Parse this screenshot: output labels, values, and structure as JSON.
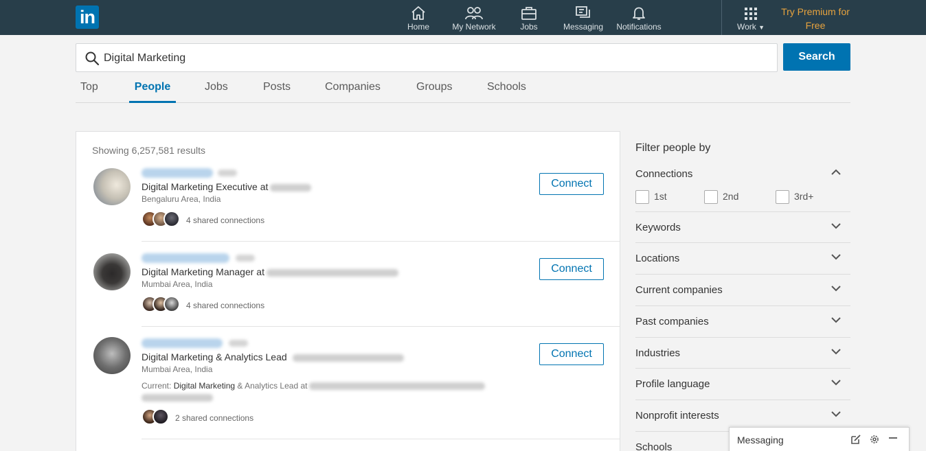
{
  "brand": {
    "logo_text": "in",
    "accent": "#0073b1",
    "topbar_bg": "#283e4a",
    "premium_color": "#e7a33e"
  },
  "nav": {
    "items": [
      {
        "label": "Home",
        "icon": "home-icon"
      },
      {
        "label": "My Network",
        "icon": "network-icon"
      },
      {
        "label": "Jobs",
        "icon": "briefcase-icon"
      },
      {
        "label": "Messaging",
        "icon": "messaging-icon"
      },
      {
        "label": "Notifications",
        "icon": "bell-icon"
      }
    ],
    "work_label": "Work",
    "premium_label": "Try Premium for Free"
  },
  "search": {
    "query": "Digital Marketing",
    "button_label": "Search"
  },
  "tabs": [
    {
      "label": "Top",
      "active": false
    },
    {
      "label": "People",
      "active": true
    },
    {
      "label": "Jobs",
      "active": false
    },
    {
      "label": "Posts",
      "active": false
    },
    {
      "label": "Companies",
      "active": false
    },
    {
      "label": "Groups",
      "active": false
    },
    {
      "label": "Schools",
      "active": false
    }
  ],
  "results": {
    "count_text": "Showing 6,257,581 results",
    "items": [
      {
        "headline": "Digital Marketing Executive at",
        "location": "Bengaluru Area, India",
        "shared": "4 shared connections",
        "connect_label": "Connect"
      },
      {
        "headline": "Digital Marketing Manager at",
        "location": "Mumbai Area, India",
        "shared": "4 shared connections",
        "connect_label": "Connect"
      },
      {
        "headline": "Digital Marketing & Analytics Lead",
        "location": "Mumbai Area, India",
        "current_prefix": "Current: ",
        "current_match": "Digital Marketing",
        "current_rest": " & Analytics Lead at",
        "shared": "2 shared connections",
        "connect_label": "Connect"
      }
    ]
  },
  "filters": {
    "title": "Filter people by",
    "connections": {
      "label": "Connections",
      "options": [
        "1st",
        "2nd",
        "3rd+"
      ]
    },
    "sections": [
      "Keywords",
      "Locations",
      "Current companies",
      "Past companies",
      "Industries",
      "Profile language",
      "Nonprofit interests",
      "Schools"
    ]
  },
  "messaging_dock": {
    "label": "Messaging"
  }
}
